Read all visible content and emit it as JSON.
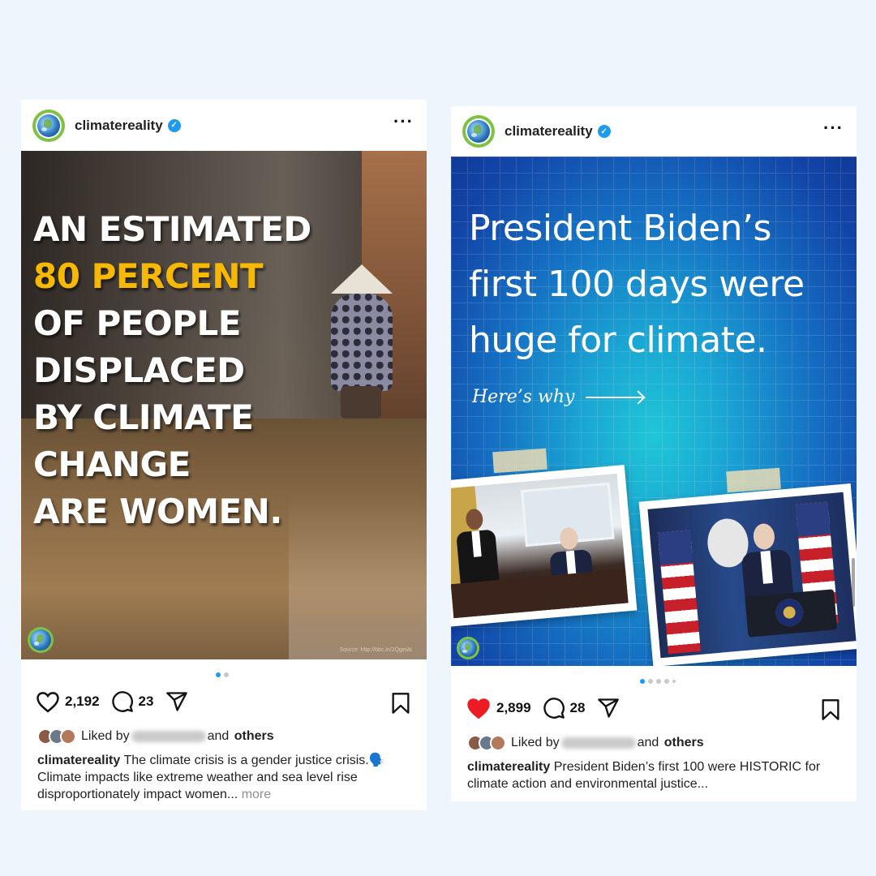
{
  "posts": [
    {
      "username": "climatereality",
      "headline": {
        "line1": "AN ESTIMATED",
        "highlight": "80 PERCENT",
        "line3": "OF PEOPLE",
        "line4": "DISPLACED",
        "line5": "BY CLIMATE",
        "line6": "CHANGE",
        "line7": "ARE WOMEN."
      },
      "source": "Source: http://bbc.in/2QgeiAt",
      "likes": "2,192",
      "comments": "23",
      "liked": false,
      "liked_by_prefix": "Liked by",
      "liked_by_suffix": "and",
      "others": "others",
      "caption_user": "climatereality",
      "caption_text": "The climate crisis is a gender justice crisis.🗣️ Climate impacts like extreme weather and sea level rise disproportionately impact women...",
      "more": "more",
      "carousel": {
        "count": 2,
        "active": 0
      }
    },
    {
      "username": "climatereality",
      "title": {
        "line1": "President Biden’s",
        "line2": "first 100 days were",
        "line3": "huge for climate."
      },
      "heres_why": "Here’s why",
      "likes": "2,899",
      "comments": "28",
      "liked": true,
      "liked_by_prefix": "Liked by",
      "liked_by_suffix": "and",
      "others": "others",
      "caption_user": "climatereality",
      "caption_text": "President Biden’s first 100 were HISTORIC for climate action and environmental justice...",
      "carousel": {
        "count": 5,
        "active": 0
      }
    }
  ],
  "colors": {
    "background": "#eef5fc",
    "highlight": "#f6b900",
    "verified": "#1d9bf0",
    "liked_heart": "#ed1c24",
    "avatar_ring": "#7dc242"
  },
  "icons": [
    "globe-avatar-icon",
    "verified-badge-icon",
    "more-options-icon",
    "heart-icon",
    "comment-icon",
    "share-icon",
    "bookmark-icon"
  ]
}
